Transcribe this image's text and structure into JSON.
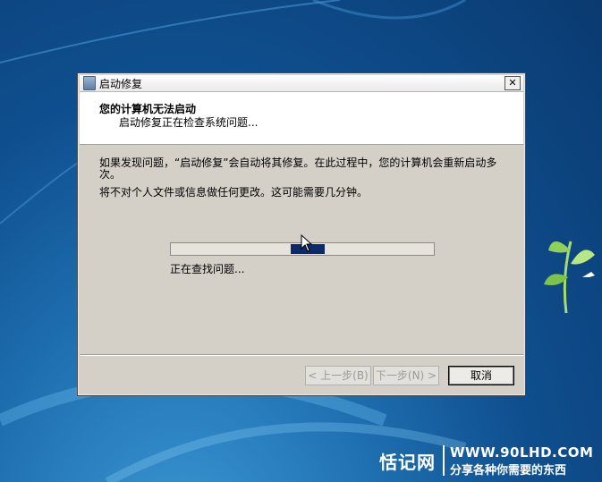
{
  "window": {
    "title": "启动修复",
    "close_symbol": "✕"
  },
  "header": {
    "heading": "您的计算机无法启动",
    "subheading": "启动修复正在检查系统问题..."
  },
  "body": {
    "paragraph1": "如果发现问题，“启动修复”会自动将其修复。在此过程中，您的计算机会重新启动多次。",
    "paragraph2": "将不对个人文件或信息做任何更改。这可能需要几分钟。"
  },
  "progress": {
    "status": "正在查找问题..."
  },
  "buttons": {
    "back": "< 上一步(B)",
    "next": "下一步(N) >",
    "cancel": "取消"
  },
  "watermark": {
    "brand": "恬记网",
    "url": "WWW.90LHD.COM",
    "slogan": "分享各种你需要的东西"
  },
  "icons": {
    "app": "startup-repair-icon",
    "close": "close-icon",
    "cursor": "mouse-pointer-icon"
  },
  "colors": {
    "progress_fill": "#0b2a6e",
    "dialog_bg": "#d4d0c8"
  }
}
